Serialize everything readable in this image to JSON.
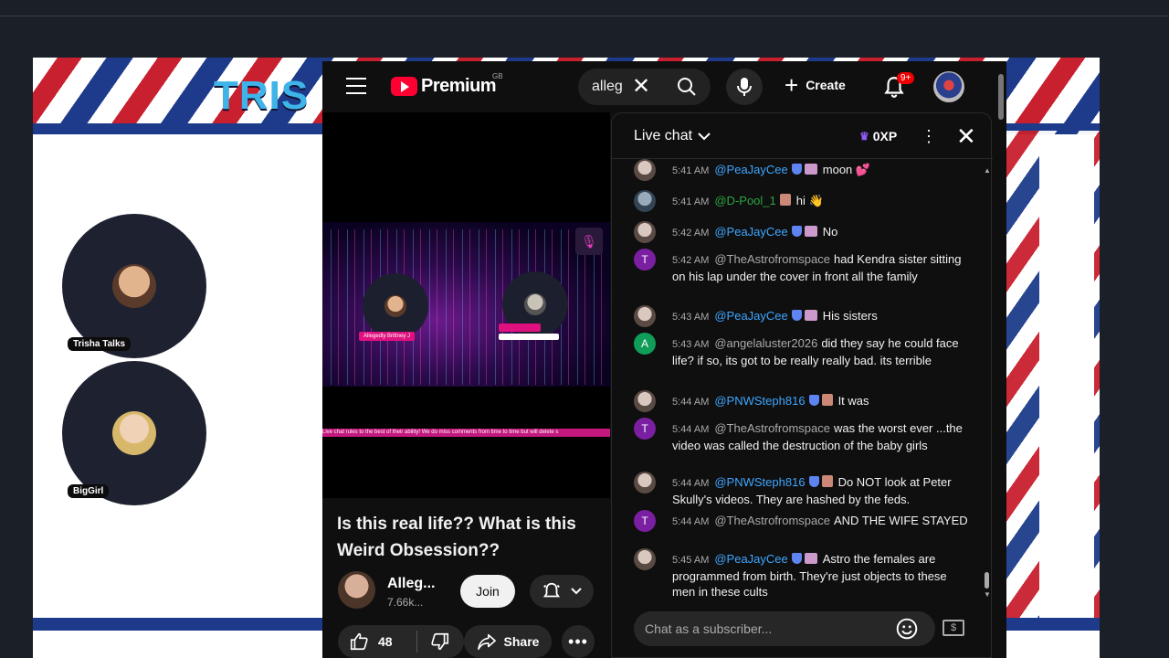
{
  "stream": {
    "banner_title": "TRIS",
    "guests": [
      {
        "label": "Trisha Talks"
      },
      {
        "label": "BigGirl"
      }
    ]
  },
  "youtube": {
    "logo_text": "Premium",
    "logo_country": "GB",
    "search": {
      "value": "alleg"
    },
    "create_label": "Create",
    "notif_badge": "9+",
    "video": {
      "guest_tags": [
        "Allegedly Brittney J",
        ""
      ],
      "ticker": "Live chat rules to the best of their ability! We do miss comments from time to time but will delete s"
    },
    "title": "Is this real life?? What is this Weird Obsession??",
    "channel": {
      "name": "Alleg...",
      "subs": "7.66k..."
    },
    "join_label": "Join",
    "likes": "48",
    "share_label": "Share"
  },
  "chat": {
    "title": "Live chat",
    "xp": "0XP",
    "input_placeholder": "Chat as a subscriber...",
    "messages": [
      {
        "time": "5:41 AM",
        "author": "@PeaJayCee",
        "style": "blue",
        "shield": true,
        "emoji": "s",
        "text": "moon 💕"
      },
      {
        "time": "5:41 AM",
        "author": "@D-Pool_1",
        "style": "green",
        "shield": false,
        "emoji": "k",
        "text": "hi 👋"
      },
      {
        "time": "5:42 AM",
        "author": "@PeaJayCee",
        "style": "blue",
        "shield": true,
        "emoji": "s",
        "text": "No"
      },
      {
        "time": "5:42 AM",
        "author": "@TheAstrofromspace",
        "style": "grey",
        "avatar_letter": "T",
        "avatar_color": "#7b1fa2",
        "text": "had Kendra sister sitting on his lap under the cover in front all the family"
      },
      {
        "time": "5:43 AM",
        "author": "@PeaJayCee",
        "style": "blue",
        "shield": true,
        "emoji": "s",
        "text": "His sisters"
      },
      {
        "time": "5:43 AM",
        "author": "@angelaluster2026",
        "style": "grey",
        "avatar_letter": "A",
        "avatar_color": "#0f9d58",
        "text": "did they say he could face life? if so, its got to be really really bad. its terrible"
      },
      {
        "time": "5:44 AM",
        "author": "@PNWSteph816",
        "style": "blue",
        "shield": true,
        "emoji": "k",
        "text": "It was"
      },
      {
        "time": "5:44 AM",
        "author": "@TheAstrofromspace",
        "style": "grey",
        "avatar_letter": "T",
        "avatar_color": "#7b1fa2",
        "text": "was the worst ever ...the video was called the destruction of the baby girls"
      },
      {
        "time": "5:44 AM",
        "author": "@PNWSteph816",
        "style": "blue",
        "shield": true,
        "emoji": "k",
        "text": "Do NOT look at Peter Skully's videos. They are hashed by the feds."
      },
      {
        "time": "5:44 AM",
        "author": "@TheAstrofromspace",
        "style": "grey",
        "avatar_letter": "T",
        "avatar_color": "#7b1fa2",
        "text": "AND THE WIFE STAYED"
      },
      {
        "time": "5:45 AM",
        "author": "@PeaJayCee",
        "style": "blue",
        "shield": true,
        "emoji": "s",
        "text": "Astro the females are programmed from birth. They're just objects to these men in these cults"
      }
    ]
  }
}
